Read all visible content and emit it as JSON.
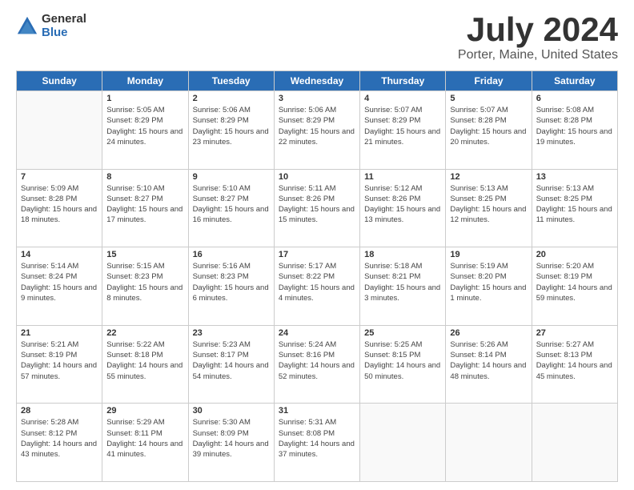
{
  "logo": {
    "general": "General",
    "blue": "Blue"
  },
  "header": {
    "title": "July 2024",
    "subtitle": "Porter, Maine, United States"
  },
  "weekdays": [
    "Sunday",
    "Monday",
    "Tuesday",
    "Wednesday",
    "Thursday",
    "Friday",
    "Saturday"
  ],
  "weeks": [
    [
      {
        "day": null
      },
      {
        "day": "1",
        "sunrise": "5:05 AM",
        "sunset": "8:29 PM",
        "daylight": "15 hours and 24 minutes."
      },
      {
        "day": "2",
        "sunrise": "5:06 AM",
        "sunset": "8:29 PM",
        "daylight": "15 hours and 23 minutes."
      },
      {
        "day": "3",
        "sunrise": "5:06 AM",
        "sunset": "8:29 PM",
        "daylight": "15 hours and 22 minutes."
      },
      {
        "day": "4",
        "sunrise": "5:07 AM",
        "sunset": "8:29 PM",
        "daylight": "15 hours and 21 minutes."
      },
      {
        "day": "5",
        "sunrise": "5:07 AM",
        "sunset": "8:28 PM",
        "daylight": "15 hours and 20 minutes."
      },
      {
        "day": "6",
        "sunrise": "5:08 AM",
        "sunset": "8:28 PM",
        "daylight": "15 hours and 19 minutes."
      }
    ],
    [
      {
        "day": "7",
        "sunrise": "5:09 AM",
        "sunset": "8:28 PM",
        "daylight": "15 hours and 18 minutes."
      },
      {
        "day": "8",
        "sunrise": "5:10 AM",
        "sunset": "8:27 PM",
        "daylight": "15 hours and 17 minutes."
      },
      {
        "day": "9",
        "sunrise": "5:10 AM",
        "sunset": "8:27 PM",
        "daylight": "15 hours and 16 minutes."
      },
      {
        "day": "10",
        "sunrise": "5:11 AM",
        "sunset": "8:26 PM",
        "daylight": "15 hours and 15 minutes."
      },
      {
        "day": "11",
        "sunrise": "5:12 AM",
        "sunset": "8:26 PM",
        "daylight": "15 hours and 13 minutes."
      },
      {
        "day": "12",
        "sunrise": "5:13 AM",
        "sunset": "8:25 PM",
        "daylight": "15 hours and 12 minutes."
      },
      {
        "day": "13",
        "sunrise": "5:13 AM",
        "sunset": "8:25 PM",
        "daylight": "15 hours and 11 minutes."
      }
    ],
    [
      {
        "day": "14",
        "sunrise": "5:14 AM",
        "sunset": "8:24 PM",
        "daylight": "15 hours and 9 minutes."
      },
      {
        "day": "15",
        "sunrise": "5:15 AM",
        "sunset": "8:23 PM",
        "daylight": "15 hours and 8 minutes."
      },
      {
        "day": "16",
        "sunrise": "5:16 AM",
        "sunset": "8:23 PM",
        "daylight": "15 hours and 6 minutes."
      },
      {
        "day": "17",
        "sunrise": "5:17 AM",
        "sunset": "8:22 PM",
        "daylight": "15 hours and 4 minutes."
      },
      {
        "day": "18",
        "sunrise": "5:18 AM",
        "sunset": "8:21 PM",
        "daylight": "15 hours and 3 minutes."
      },
      {
        "day": "19",
        "sunrise": "5:19 AM",
        "sunset": "8:20 PM",
        "daylight": "15 hours and 1 minute."
      },
      {
        "day": "20",
        "sunrise": "5:20 AM",
        "sunset": "8:19 PM",
        "daylight": "14 hours and 59 minutes."
      }
    ],
    [
      {
        "day": "21",
        "sunrise": "5:21 AM",
        "sunset": "8:19 PM",
        "daylight": "14 hours and 57 minutes."
      },
      {
        "day": "22",
        "sunrise": "5:22 AM",
        "sunset": "8:18 PM",
        "daylight": "14 hours and 55 minutes."
      },
      {
        "day": "23",
        "sunrise": "5:23 AM",
        "sunset": "8:17 PM",
        "daylight": "14 hours and 54 minutes."
      },
      {
        "day": "24",
        "sunrise": "5:24 AM",
        "sunset": "8:16 PM",
        "daylight": "14 hours and 52 minutes."
      },
      {
        "day": "25",
        "sunrise": "5:25 AM",
        "sunset": "8:15 PM",
        "daylight": "14 hours and 50 minutes."
      },
      {
        "day": "26",
        "sunrise": "5:26 AM",
        "sunset": "8:14 PM",
        "daylight": "14 hours and 48 minutes."
      },
      {
        "day": "27",
        "sunrise": "5:27 AM",
        "sunset": "8:13 PM",
        "daylight": "14 hours and 45 minutes."
      }
    ],
    [
      {
        "day": "28",
        "sunrise": "5:28 AM",
        "sunset": "8:12 PM",
        "daylight": "14 hours and 43 minutes."
      },
      {
        "day": "29",
        "sunrise": "5:29 AM",
        "sunset": "8:11 PM",
        "daylight": "14 hours and 41 minutes."
      },
      {
        "day": "30",
        "sunrise": "5:30 AM",
        "sunset": "8:09 PM",
        "daylight": "14 hours and 39 minutes."
      },
      {
        "day": "31",
        "sunrise": "5:31 AM",
        "sunset": "8:08 PM",
        "daylight": "14 hours and 37 minutes."
      },
      {
        "day": null
      },
      {
        "day": null
      },
      {
        "day": null
      }
    ]
  ],
  "labels": {
    "sunrise_prefix": "Sunrise: ",
    "sunset_prefix": "Sunset: ",
    "daylight_prefix": "Daylight: "
  }
}
